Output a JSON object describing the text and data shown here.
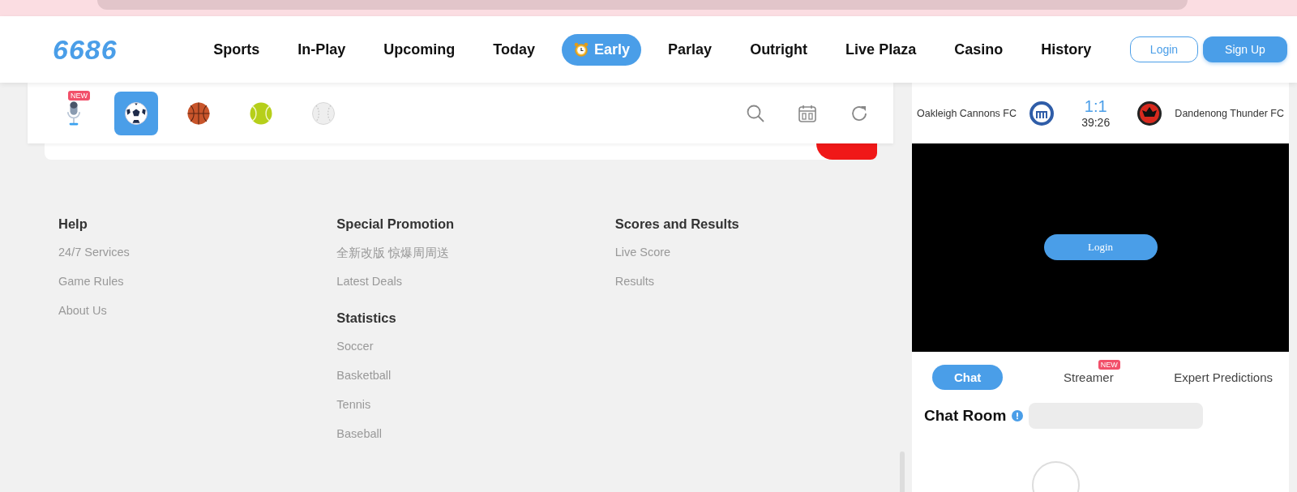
{
  "logo": "6686",
  "nav": [
    {
      "label": "Sports",
      "selected": false
    },
    {
      "label": "In-Play",
      "selected": false
    },
    {
      "label": "Upcoming",
      "selected": false
    },
    {
      "label": "Today",
      "selected": false
    },
    {
      "label": "Early",
      "selected": true
    },
    {
      "label": "Parlay",
      "selected": false
    },
    {
      "label": "Outright",
      "selected": false
    },
    {
      "label": "Live Plaza",
      "selected": false
    },
    {
      "label": "Casino",
      "selected": false
    },
    {
      "label": "History",
      "selected": false
    }
  ],
  "auth": {
    "login": "Login",
    "signup": "Sign Up"
  },
  "sports": [
    {
      "kind": "mic",
      "selected": false,
      "badge": "NEW"
    },
    {
      "kind": "soccer",
      "selected": true
    },
    {
      "kind": "basketball",
      "selected": false
    },
    {
      "kind": "tennis",
      "selected": false
    },
    {
      "kind": "baseball",
      "selected": false
    }
  ],
  "footer": [
    {
      "sections": [
        {
          "title": "Help",
          "links": [
            "24/7 Services",
            "Game Rules",
            "About Us"
          ]
        }
      ]
    },
    {
      "sections": [
        {
          "title": "Special Promotion",
          "links": [
            "全新改版 惊爆周周送",
            "Latest Deals"
          ]
        },
        {
          "title": "Statistics",
          "links": [
            "Soccer",
            "Basketball",
            "Tennis",
            "Baseball"
          ]
        }
      ]
    },
    {
      "sections": [
        {
          "title": "Scores and Results",
          "links": [
            "Live Score",
            "Results"
          ]
        }
      ]
    }
  ],
  "match": {
    "home": "Oakleigh Cannons FC",
    "away": "Dandenong Thunder FC",
    "score": "1:1",
    "time": "39:26",
    "login": "Login"
  },
  "chat_tabs": [
    {
      "label": "Chat",
      "selected": true
    },
    {
      "label": "Streamer",
      "selected": false,
      "badge": "NEW"
    },
    {
      "label": "Expert Predictions",
      "selected": false
    }
  ],
  "chat_room": {
    "title": "Chat Room"
  }
}
